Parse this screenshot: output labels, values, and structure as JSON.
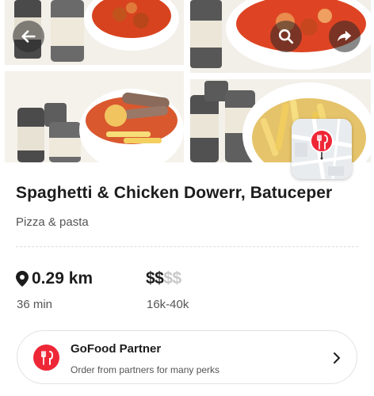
{
  "restaurant": {
    "name": "Spaghetti & Chicken Dowerr, Batuceper",
    "category": "Pizza & pasta",
    "distance": "0.29 km",
    "delivery_time": "36 min",
    "price_level": {
      "active": "$$",
      "inactive": "$$",
      "level": 2,
      "max": 4
    },
    "price_range": "16k-40k"
  },
  "partner_card": {
    "title": "GoFood Partner",
    "subtitle": "Order from partners for many perks"
  },
  "icons": {
    "back": "arrow-left-icon",
    "search": "search-icon",
    "share": "share-icon",
    "location": "location-pin-icon",
    "partner": "fork-knife-icon",
    "chevron": "chevron-right-icon",
    "map_marker": "restaurant-marker-icon"
  },
  "colors": {
    "brand_red": "#ee2737",
    "text_primary": "#1c1c1c",
    "text_secondary": "#555555",
    "price_inactive": "#c8c8c8"
  }
}
